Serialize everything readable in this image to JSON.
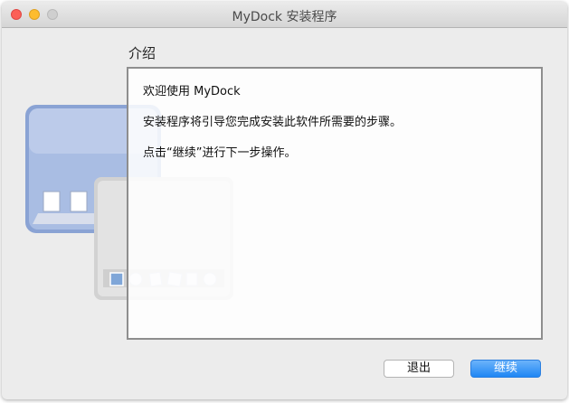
{
  "window": {
    "title": "MyDock 安装程序"
  },
  "section": {
    "title": "介绍"
  },
  "content": {
    "lines": [
      "欢迎使用 MyDock",
      "安装程序将引导您完成安装此软件所需要的步骤。",
      "点击“继续”进行下一步操作。"
    ]
  },
  "buttons": {
    "quit": "退出",
    "continue": "继续"
  },
  "colors": {
    "accent": "#1f86f4",
    "close": "#fc5f57",
    "minimize": "#fdbc2e"
  },
  "icons": [
    "close-window-icon",
    "minimize-window-icon",
    "zoom-window-icon",
    "mydock-app-icon"
  ]
}
